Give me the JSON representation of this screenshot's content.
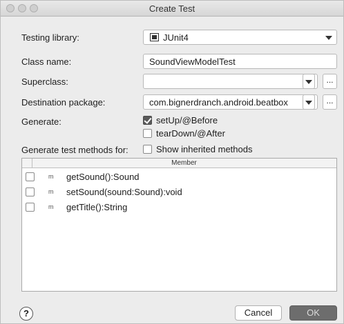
{
  "window": {
    "title": "Create Test"
  },
  "form": {
    "testing_library_label": "Testing library:",
    "testing_library_value": "JUnit4",
    "class_name_label": "Class name:",
    "class_name_value": "SoundViewModelTest",
    "superclass_label": "Superclass:",
    "superclass_value": "",
    "destination_label": "Destination package:",
    "destination_value": "com.bignerdranch.android.beatbox",
    "more_label": "...",
    "generate_label": "Generate:",
    "setup_label": "setUp/@Before",
    "setup_checked": true,
    "teardown_label": "tearDown/@After",
    "teardown_checked": false,
    "methods_label": "Generate test methods for:",
    "inherited_label": "Show inherited methods",
    "inherited_checked": false
  },
  "table": {
    "column_header": "Member",
    "method_icon_glyph": "m",
    "rows": [
      {
        "name": "getSound():Sound",
        "checked": false
      },
      {
        "name": "setSound(sound:Sound):void",
        "checked": false
      },
      {
        "name": "getTitle():String",
        "checked": false
      }
    ]
  },
  "footer": {
    "help_label": "?",
    "cancel_label": "Cancel",
    "ok_label": "OK"
  },
  "icons": {
    "title_dots": "window-control-dot",
    "testing_library": "junit-icon",
    "method": "method-icon",
    "help": "help-icon"
  }
}
